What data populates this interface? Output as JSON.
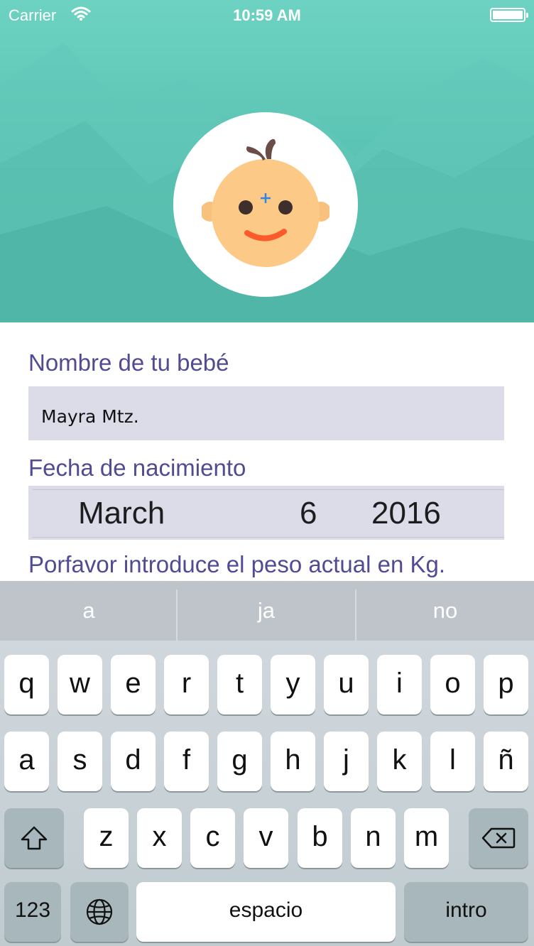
{
  "status_bar": {
    "carrier": "Carrier",
    "time": "10:59 AM"
  },
  "header": {
    "avatar_icon": "baby-face-icon",
    "add_photo_icon": "plus-icon",
    "theme_color": "#5cc4b4"
  },
  "form": {
    "name_label": "Nombre de tu bebé",
    "name_value": "Mayra Mtz.",
    "birth_label": "Fecha de nacimiento",
    "birth_date": {
      "month": "March",
      "day": "6",
      "year": "2016"
    },
    "weight_label": "Porfavor introduce el peso actual en Kg.",
    "label_color": "#514b93"
  },
  "keyboard": {
    "suggestions": [
      "a",
      "ja",
      "no"
    ],
    "rows": [
      [
        "q",
        "w",
        "e",
        "r",
        "t",
        "y",
        "u",
        "i",
        "o",
        "p"
      ],
      [
        "a",
        "s",
        "d",
        "f",
        "g",
        "h",
        "j",
        "k",
        "l",
        "ñ"
      ],
      [
        "z",
        "x",
        "c",
        "v",
        "b",
        "n",
        "m"
      ]
    ],
    "numbers_label": "123",
    "space_label": "espacio",
    "return_label": "intro",
    "shift_icon": "shift-icon",
    "delete_icon": "backspace-icon",
    "globe_icon": "globe-icon"
  }
}
